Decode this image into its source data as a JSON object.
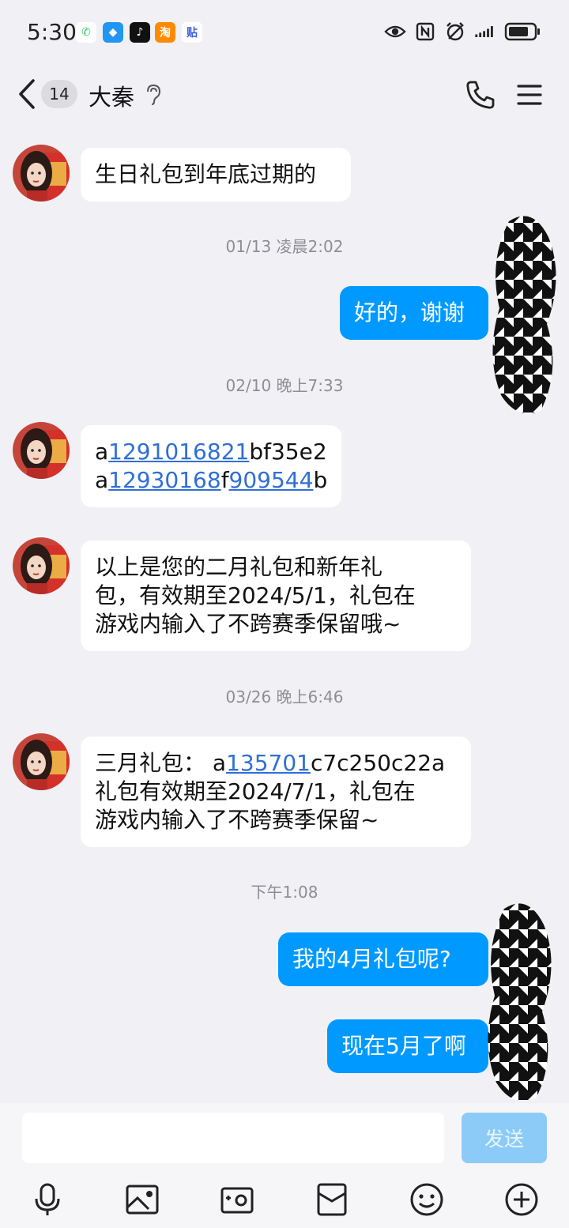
{
  "status_bar": {
    "time": "5:30",
    "app_icons": [
      {
        "name": "phone-app-icon",
        "glyph": "✆",
        "color": "#ffffff",
        "fg": "#2ec866"
      },
      {
        "name": "messages-app-icon",
        "glyph": "◆",
        "color": "#2196f3",
        "fg": "#ffffff"
      },
      {
        "name": "tiktok-app-icon",
        "glyph": "♪",
        "color": "#111111",
        "fg": "#ffffff"
      },
      {
        "name": "taobao-app-icon",
        "glyph": "淘",
        "color": "#ff8a00",
        "fg": "#ffffff"
      },
      {
        "name": "tieba-app-icon",
        "glyph": "贴",
        "color": "#ffffff",
        "fg": "#3b5bdb"
      }
    ],
    "system_icons": [
      "eye-icon",
      "nfc-icon",
      "alarm-icon",
      "signal-icon",
      "battery-icon"
    ],
    "battery_level": 0.8
  },
  "header": {
    "unread_count": "14",
    "title": "大秦"
  },
  "messages": [
    {
      "type": "in",
      "lines": [
        [
          {
            "t": "生日礼包到年底过期的"
          }
        ]
      ]
    },
    {
      "type": "time",
      "text": "01/13 凌晨2:02"
    },
    {
      "type": "out",
      "lines": [
        [
          {
            "t": "好的，谢谢"
          }
        ]
      ]
    },
    {
      "type": "time",
      "text": "02/10 晚上7:33"
    },
    {
      "type": "in",
      "lines": [
        [
          {
            "t": "a"
          },
          {
            "t": "1291016821",
            "link": true
          },
          {
            "t": "bf35e2"
          }
        ],
        [
          {
            "t": "a"
          },
          {
            "t": "12930168",
            "link": true
          },
          {
            "t": "f"
          },
          {
            "t": "909544",
            "link": true
          },
          {
            "t": "b"
          }
        ]
      ]
    },
    {
      "type": "in",
      "lines": [
        [
          {
            "t": "以上是您的二月礼包和新年礼"
          }
        ],
        [
          {
            "t": "包，有效期至2024/5/1，礼包在"
          }
        ],
        [
          {
            "t": "游戏内输入了不跨赛季保留哦~"
          }
        ]
      ]
    },
    {
      "type": "time",
      "text": "03/26 晚上6:46"
    },
    {
      "type": "in",
      "lines": [
        [
          {
            "t": "三月礼包： a"
          },
          {
            "t": "135701",
            "link": true
          },
          {
            "t": "c7c250c22a"
          }
        ],
        [
          {
            "t": "礼包有效期至2024/7/1，礼包在"
          }
        ],
        [
          {
            "t": "游戏内输入了不跨赛季保留~"
          }
        ]
      ]
    },
    {
      "type": "time",
      "text": "下午1:08"
    },
    {
      "type": "out",
      "lines": [
        [
          {
            "t": "我的4月礼包呢?"
          }
        ]
      ]
    },
    {
      "type": "out",
      "lines": [
        [
          {
            "t": "现在5月了啊"
          }
        ]
      ]
    }
  ],
  "composer": {
    "placeholder": "",
    "send_label": "发送"
  },
  "toolbar": [
    "microphone-icon",
    "image-icon",
    "camera-icon",
    "red-packet-icon",
    "emoji-icon",
    "plus-icon"
  ],
  "colors": {
    "outgoing_bubble": "#0099ff",
    "incoming_bubble": "#ffffff",
    "link": "#2f6fd6",
    "background": "#f1f1f5"
  }
}
